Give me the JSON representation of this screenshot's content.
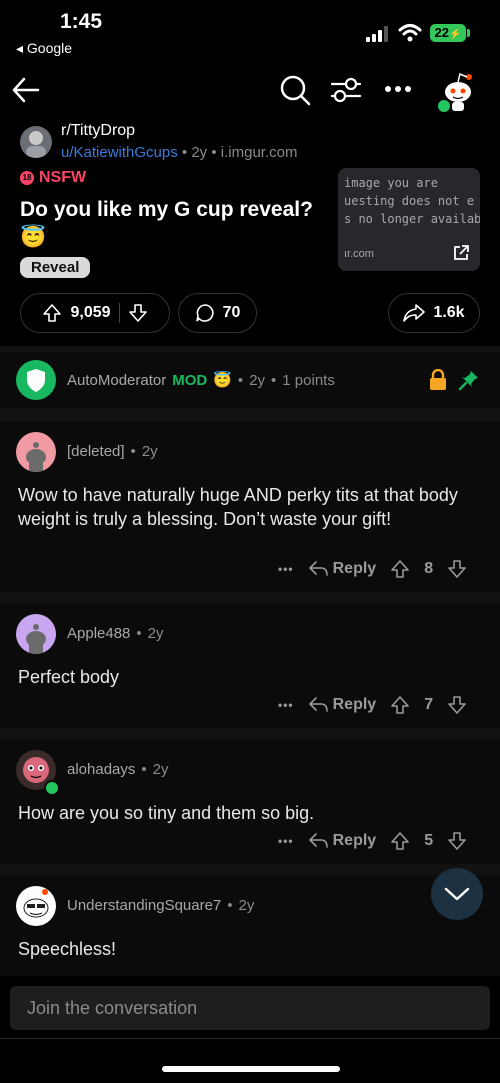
{
  "status_bar": {
    "time": "1:45",
    "back_app": "◂ Google",
    "battery": "22"
  },
  "post": {
    "subreddit": "r/TittyDrop",
    "author": "u/KatiewithGcups",
    "age": "2y",
    "domain": "i.imgur.com",
    "nsfw_label": "NSFW",
    "title": "Do you like my G cup reveal? 😇",
    "tag": "Reveal",
    "thumbnail_text": "image you are\nuesting does not e\ns no longer availab",
    "thumbnail_domain": "ır.com",
    "upvotes": "9,059",
    "comments": "70",
    "shares": "1.6k"
  },
  "comments": [
    {
      "name": "AutoModerator",
      "badge": "MOD",
      "age": "2y",
      "points": "1 points",
      "body": ""
    },
    {
      "name": "[deleted]",
      "age": "2y",
      "body": "Wow to have naturally huge AND perky tits at that body weight is truly a blessing. Don’t waste your gift!",
      "votes": "8"
    },
    {
      "name": "Apple488",
      "age": "2y",
      "body": "Perfect body",
      "votes": "7"
    },
    {
      "name": "alohadays",
      "age": "2y",
      "body": "How are you so tiny and them so big.",
      "votes": "5"
    },
    {
      "name": "UnderstandingSquare7",
      "age": "2y",
      "body": "Speechless!"
    }
  ],
  "labels": {
    "reply": "Reply",
    "more": "•••",
    "separator": "•"
  },
  "composer": {
    "placeholder": "Join the conversation"
  },
  "colors": {
    "nsfw": "#ff4466",
    "mod": "#18b860",
    "link": "#3d7bd8",
    "online": "#22c55e"
  }
}
